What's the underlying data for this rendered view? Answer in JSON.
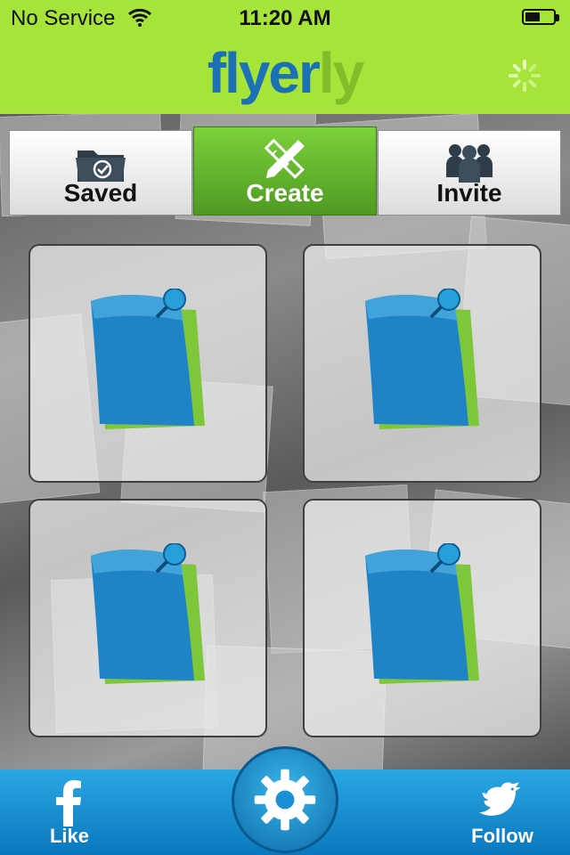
{
  "status_bar": {
    "carrier": "No Service",
    "time": "11:20 AM",
    "battery_level": 0.45
  },
  "header": {
    "logo_part1": "flyer",
    "logo_part2": "ly",
    "brand_blue": "#1c70b5",
    "brand_green": "#7fbe2a",
    "spinner_icon": "activity-spinner-icon"
  },
  "tabs": [
    {
      "label": "Saved",
      "icon": "folder-check-icon",
      "active": false
    },
    {
      "label": "Create",
      "icon": "pencil-ruler-icon",
      "active": true
    },
    {
      "label": "Invite",
      "icon": "people-group-icon",
      "active": false
    }
  ],
  "slots": [
    {
      "icon": "pinned-note-icon"
    },
    {
      "icon": "pinned-note-icon"
    },
    {
      "icon": "pinned-note-icon"
    },
    {
      "icon": "pinned-note-icon"
    }
  ],
  "bottom_bar": {
    "like_label": "Like",
    "follow_label": "Follow",
    "like_icon": "facebook-icon",
    "follow_icon": "twitter-bird-icon",
    "settings_icon": "gear-icon"
  },
  "colors": {
    "header_green": "#a6e43a",
    "active_tab": "#5fae2b",
    "bottom_blue": "#1a8fd3"
  }
}
